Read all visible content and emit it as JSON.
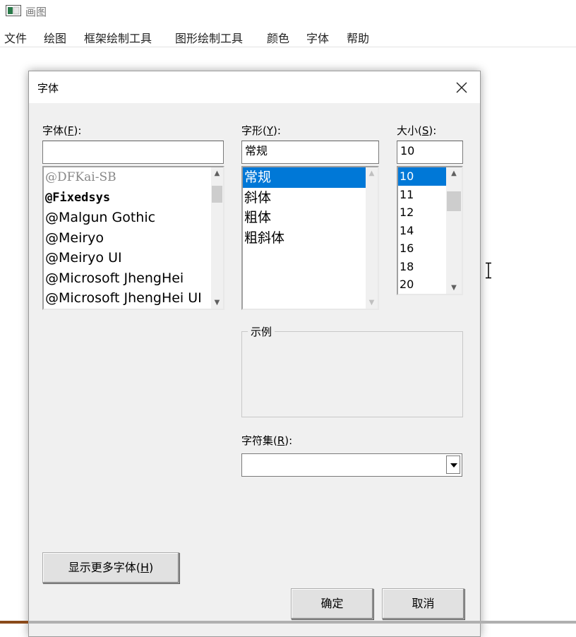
{
  "app": {
    "title": "画图",
    "icon": "paint-app-icon"
  },
  "menubar": {
    "items": [
      "文件",
      "绘图",
      "框架绘制工具",
      "图形绘制工具",
      "颜色",
      "字体",
      "帮助"
    ]
  },
  "dialog": {
    "title": "字体",
    "font": {
      "label": "字体(F):",
      "label_main": "字体(",
      "label_key": "F",
      "label_tail": "):",
      "value": "",
      "items": [
        "@DFKai-SB",
        "@Fixedsys",
        "@Malgun Gothic",
        "@Meiryo",
        "@Meiryo UI",
        "@Microsoft JhengHei",
        "@Microsoft JhengHei UI"
      ]
    },
    "style": {
      "label": "字形(Y):",
      "label_main": "字形(",
      "label_key": "Y",
      "label_tail": "):",
      "value": "常规",
      "items": [
        "常规",
        "斜体",
        "粗体",
        "粗斜体"
      ],
      "selected": "常规"
    },
    "size": {
      "label": "大小(S):",
      "label_main": "大小(",
      "label_key": "S",
      "label_tail": "):",
      "value": "10",
      "items": [
        "10",
        "11",
        "12",
        "14",
        "16",
        "18",
        "20"
      ],
      "selected": "10"
    },
    "sample": {
      "label": "示例"
    },
    "charset": {
      "label": "字符集(R):",
      "label_main": "字符集(",
      "label_key": "R",
      "label_tail": "):",
      "value": ""
    },
    "buttons": {
      "more_fonts": "显示更多字体(H)",
      "more_fonts_main": "显示更多字体(",
      "more_fonts_key": "H",
      "more_fonts_tail": ")",
      "ok": "确定",
      "cancel": "取消"
    }
  },
  "colors": {
    "selection": "#0078d7",
    "dialog_bg": "#f0f0f0",
    "button_bg": "#e1e1e1"
  }
}
